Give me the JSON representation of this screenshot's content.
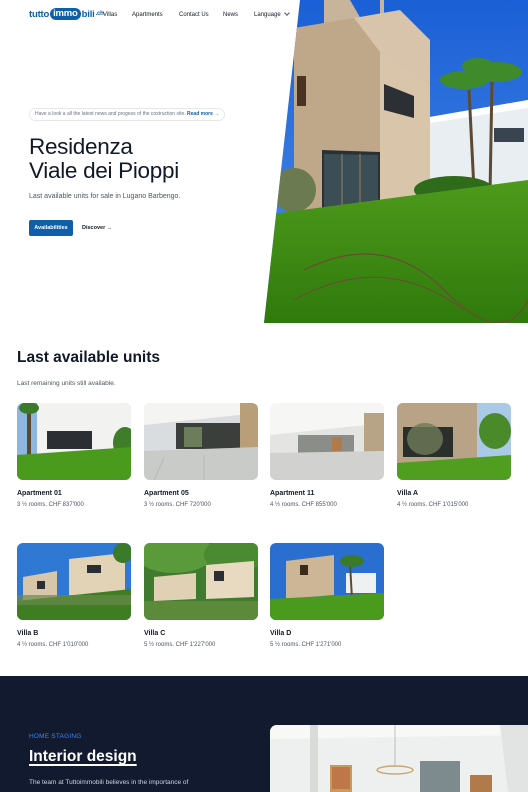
{
  "brand": {
    "part1": "tutto",
    "part2": "immo",
    "part3": "bili",
    "suffix": ".ch"
  },
  "nav": {
    "villas": "Villas",
    "apartments": "Apartments",
    "contact": "Contact Us",
    "news": "News",
    "language": "Language"
  },
  "hero": {
    "notice_text": "Have a look a all the latest news and progess of the costruction site.",
    "notice_link": "Read more →",
    "title_line1": "Residenza",
    "title_line2": "Viale dei Pioppi",
    "subtitle": "Last available units for sale in Lugano Barbengo.",
    "primary_button": "Availabilities",
    "secondary_link": "Discover →"
  },
  "units": {
    "title": "Last available units",
    "subtitle": "Last remaining units still available.",
    "items": [
      {
        "name": "Apartment 01",
        "info": "3 ½ rooms. CHF 837'000"
      },
      {
        "name": "Apartment 05",
        "info": "3 ½ rooms. CHF 720'000"
      },
      {
        "name": "Apartment 11",
        "info": "4 ½ rooms. CHF 855'000"
      },
      {
        "name": "Villa A",
        "info": "4 ½ rooms. CHF 1'015'000"
      },
      {
        "name": "Villa B",
        "info": "4 ½ rooms. CHF 1'010'000"
      },
      {
        "name": "Villa C",
        "info": "5 ½ rooms. CHF 1'227'000"
      },
      {
        "name": "Villa D",
        "info": "5 ½ rooms. CHF 1'271'000"
      }
    ]
  },
  "staging": {
    "eyebrow": "HOME STAGING",
    "title": "Interior design",
    "body": "The team at Tuttoimmobili believes in the importance of"
  },
  "colors": {
    "accent": "#0f5fa8",
    "dark_bg": "#111a2e",
    "eyebrow": "#3b82f6"
  }
}
